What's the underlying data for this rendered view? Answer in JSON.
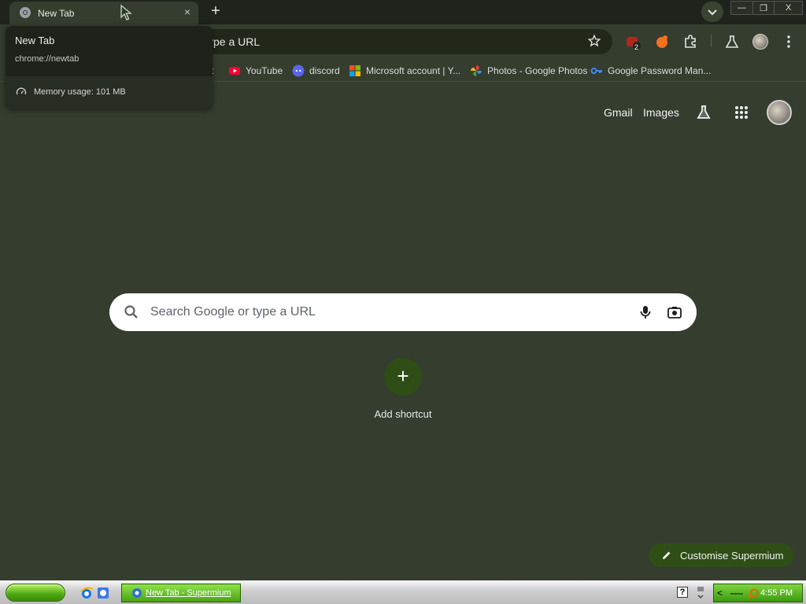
{
  "tab": {
    "title": "New Tab",
    "close_glyph": "×"
  },
  "newtab_button": {
    "glyph": "+"
  },
  "window_controls": {
    "minimize": "—",
    "restore": "❐",
    "close": "X"
  },
  "hovercard": {
    "title": "New Tab",
    "url": "chrome://newtab",
    "memory": "Memory usage: 101 MB"
  },
  "omnibox": {
    "text": "ype a URL"
  },
  "toolbar": {
    "extension_badge": "2"
  },
  "bookmarks": [
    {
      "label": "t",
      "icon": "partial-icon"
    },
    {
      "label": "YouTube",
      "icon": "youtube-icon",
      "color": "#ff0033"
    },
    {
      "label": "discord",
      "icon": "discord-icon",
      "color": "#5865f2"
    },
    {
      "label": "Microsoft account | Y...",
      "icon": "microsoft-icon"
    },
    {
      "label": "Photos - Google Photos",
      "icon": "google-photos-icon"
    },
    {
      "label": "Google Password Man...",
      "icon": "key-icon",
      "color": "#4285f4"
    }
  ],
  "ntp": {
    "gmail": "Gmail",
    "images": "Images",
    "search_placeholder": "Search Google or type a URL",
    "add_shortcut": "Add shortcut",
    "customise": "Customise Supermium"
  },
  "taskbar": {
    "task_label": "New Tab - Supermium",
    "help": "?",
    "tray_arrow": "<",
    "clock": "4:55 PM"
  },
  "colors": {
    "background": "#353d2f",
    "accent": "#2f4e16",
    "start_green": "#4da711"
  }
}
